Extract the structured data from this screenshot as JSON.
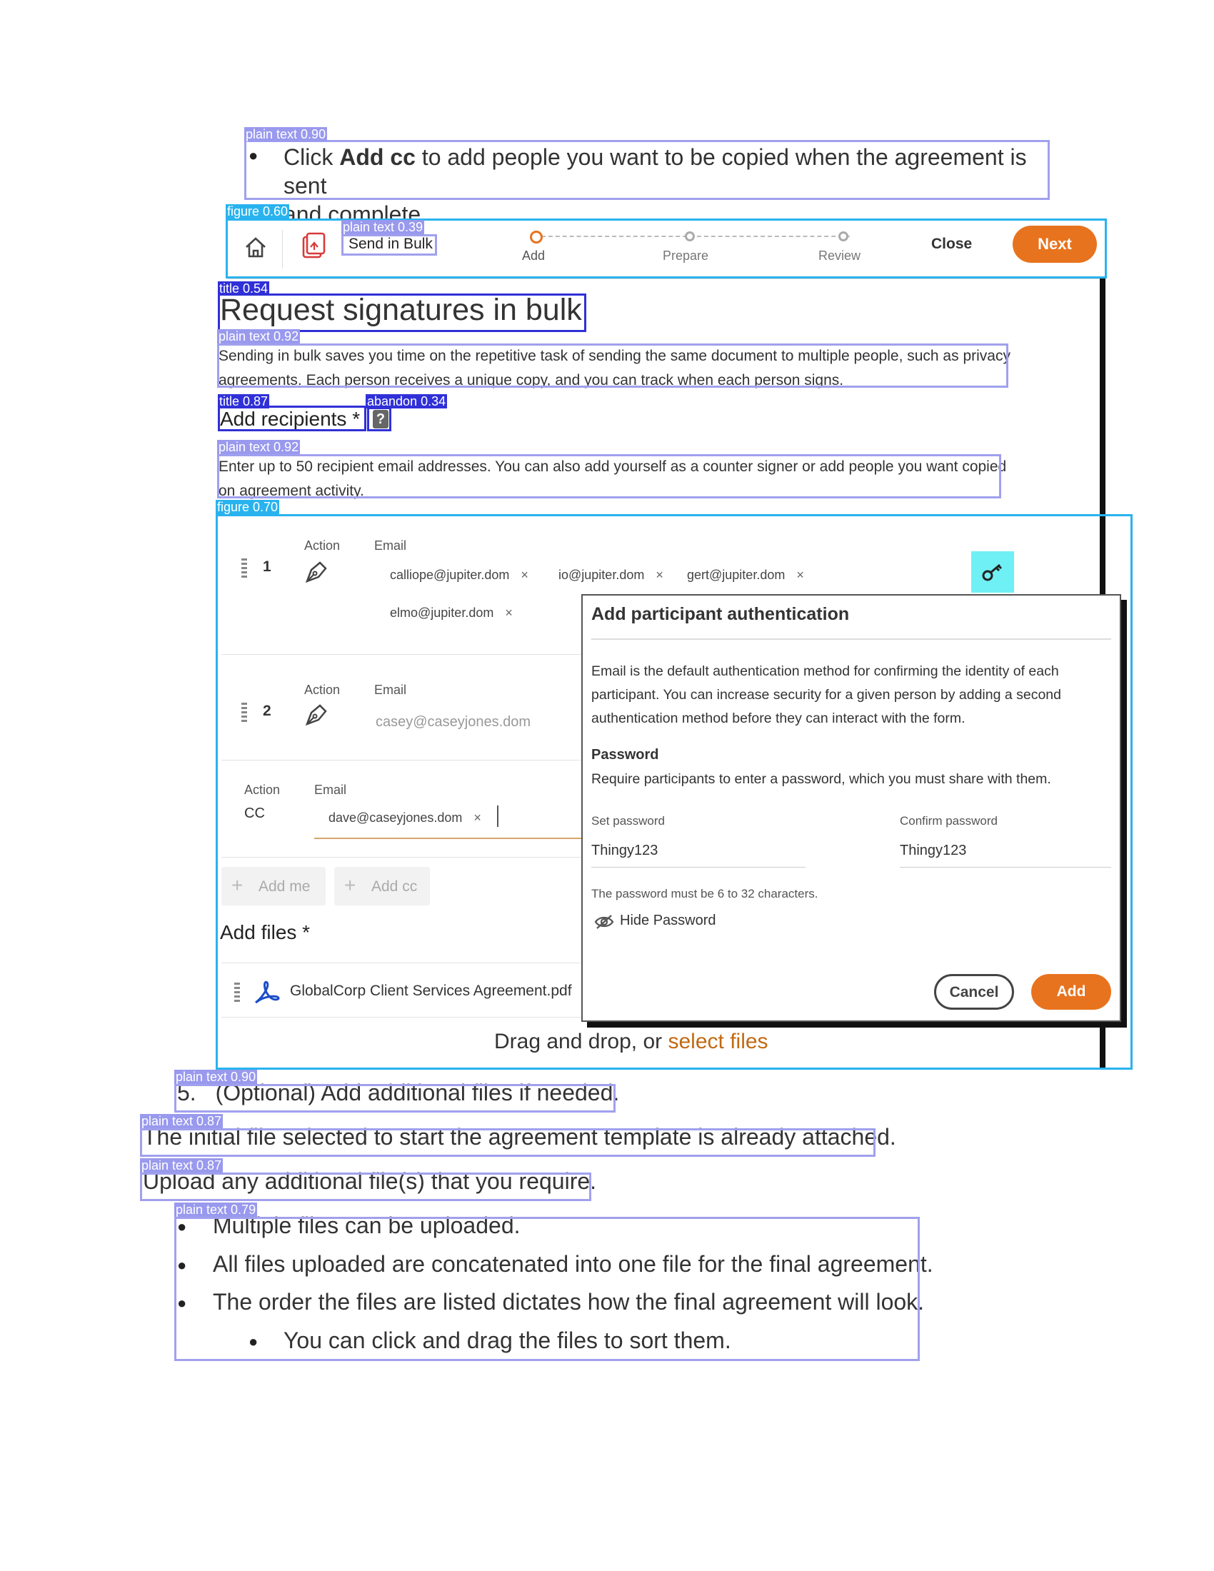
{
  "bullet_top": {
    "pre": "Click ",
    "bold": "Add cc",
    "post": " to add people you want to be copied when the agreement is sent",
    "line2": "and complete."
  },
  "toolbar": {
    "send_in_bulk": "Send in Bulk",
    "steps": [
      "Add",
      "Prepare",
      "Review"
    ],
    "close_label": "Close",
    "next_label": "Next",
    "accent": "#e8731e"
  },
  "page": {
    "title": "Request signatures in bulk",
    "intro_line1": "Sending in bulk saves you time on the repetitive task of sending the same document to multiple people, such as privacy",
    "intro_line2": "agreements. Each person receives a unique copy, and you can track when each person signs.",
    "recipients_heading": "Add recipients *",
    "help_glyph": "?",
    "recipients_desc_line1": "Enter up to 50 recipient email addresses. You can also add yourself as a counter signer or add people you want copied",
    "recipients_desc_line2": "on agreement activity."
  },
  "recipients": {
    "action_label": "Action",
    "email_label": "Email",
    "row1_number": "1",
    "row1_chips": [
      "calliope@jupiter.dom",
      "io@jupiter.dom",
      "gert@jupiter.dom",
      "elmo@jupiter.dom"
    ],
    "row2_number": "2",
    "row2_placeholder": "casey@caseyjones.dom",
    "cc_action": "CC",
    "cc_chip": "dave@caseyjones.dom",
    "add_me": "Add me",
    "add_cc": "Add cc",
    "remove_glyph": "×"
  },
  "files": {
    "heading": "Add files *",
    "file_name": "GlobalCorp Client Services Agreement.pdf",
    "drop_text": "Drag and drop, or ",
    "drop_link": "select files"
  },
  "modal": {
    "title": "Add participant authentication",
    "desc_line1": "Email is the default authentication method for confirming the identity of each",
    "desc_line2": "participant. You can increase security for a given person by adding a second",
    "desc_line3": "authentication method before they can interact with the form.",
    "password_heading": "Password",
    "password_desc": "Require participants to enter a password, which you must share with them.",
    "set_password_label": "Set password",
    "set_password_value": "Thingy123",
    "confirm_password_label": "Confirm password",
    "confirm_password_value": "Thingy123",
    "hint": "The password must be 6 to 32 characters.",
    "hide_password": "Hide Password",
    "cancel_label": "Cancel",
    "add_label": "Add"
  },
  "steps_after": {
    "step5_number": "5.",
    "step5_text": "(Optional) Add additional files if needed.",
    "para1": "The initial file selected to start the agreement template is already attached.",
    "para2": "Upload any additional file(s) that you require.",
    "bullets": [
      "Multiple files can be uploaded.",
      "All files uploaded are concatenated into one file for the final agreement.",
      "The order the files are listed dictates how the final agreement will look."
    ],
    "sub_bullet": "You can click and drag the files to sort them."
  },
  "detections": [
    {
      "label": "plain text 0.90"
    },
    {
      "label": "figure 0.60"
    },
    {
      "label": "plain text 0.39"
    },
    {
      "label": "title 0.54"
    },
    {
      "label": "plain text 0.92"
    },
    {
      "label": "title 0.87"
    },
    {
      "label": "abandon 0.34"
    },
    {
      "label": "plain text 0.92"
    },
    {
      "label": "figure 0.70"
    },
    {
      "label": "plain text 0.90"
    },
    {
      "label": "plain text 0.87"
    },
    {
      "label": "plain text 0.87"
    },
    {
      "label": "plain text 0.79"
    }
  ]
}
